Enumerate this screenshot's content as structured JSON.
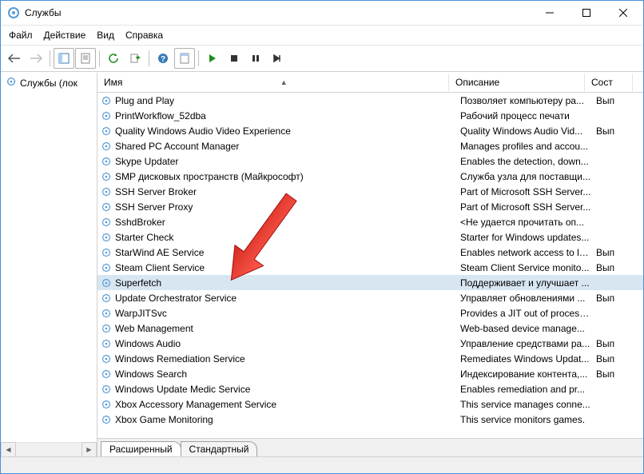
{
  "window": {
    "title": "Службы"
  },
  "menu": {
    "file": "Файл",
    "action": "Действие",
    "view": "Вид",
    "help": "Справка"
  },
  "tree": {
    "root": "Службы (лок"
  },
  "columns": {
    "name": "Имя",
    "description": "Описание",
    "status": "Сост"
  },
  "tabs": {
    "extended": "Расширенный",
    "standard": "Стандартный"
  },
  "services": [
    {
      "name": "Plug and Play",
      "desc": "Позволяет компьютеру ра...",
      "status": "Вып"
    },
    {
      "name": "PrintWorkflow_52dba",
      "desc": "Рабочий процесс печати",
      "status": ""
    },
    {
      "name": "Quality Windows Audio Video Experience",
      "desc": "Quality Windows Audio Vid...",
      "status": "Вып"
    },
    {
      "name": "Shared PC Account Manager",
      "desc": "Manages profiles and accou...",
      "status": ""
    },
    {
      "name": "Skype Updater",
      "desc": "Enables the detection, down...",
      "status": ""
    },
    {
      "name": "SMP дисковых пространств (Майкрософт)",
      "desc": "Служба узла для поставщи...",
      "status": ""
    },
    {
      "name": "SSH Server Broker",
      "desc": "Part of Microsoft SSH Server...",
      "status": ""
    },
    {
      "name": "SSH Server Proxy",
      "desc": "Part of Microsoft SSH Server...",
      "status": ""
    },
    {
      "name": "SshdBroker",
      "desc": "<Не удается прочитать оп...",
      "status": ""
    },
    {
      "name": "Starter Check",
      "desc": "Starter for Windows updates...",
      "status": ""
    },
    {
      "name": "StarWind AE Service",
      "desc": "Enables network access to lo...",
      "status": "Вып"
    },
    {
      "name": "Steam Client Service",
      "desc": "Steam Client Service monito...",
      "status": "Вып"
    },
    {
      "name": "Superfetch",
      "desc": "Поддерживает и улучшает ...",
      "status": "",
      "selected": true
    },
    {
      "name": "Update Orchestrator Service",
      "desc": "Управляет обновлениями ...",
      "status": "Вып"
    },
    {
      "name": "WarpJITSvc",
      "desc": "Provides a JIT out of process...",
      "status": ""
    },
    {
      "name": "Web Management",
      "desc": "Web-based device manage...",
      "status": ""
    },
    {
      "name": "Windows Audio",
      "desc": "Управление средствами ра...",
      "status": "Вып"
    },
    {
      "name": "Windows Remediation Service",
      "desc": "Remediates Windows Updat...",
      "status": "Вып"
    },
    {
      "name": "Windows Search",
      "desc": "Индексирование контента,...",
      "status": "Вып"
    },
    {
      "name": "Windows Update Medic Service",
      "desc": "Enables remediation and pr...",
      "status": ""
    },
    {
      "name": "Xbox Accessory Management Service",
      "desc": "This service manages conne...",
      "status": ""
    },
    {
      "name": "Xbox Game Monitoring",
      "desc": "This service monitors games.",
      "status": ""
    }
  ]
}
